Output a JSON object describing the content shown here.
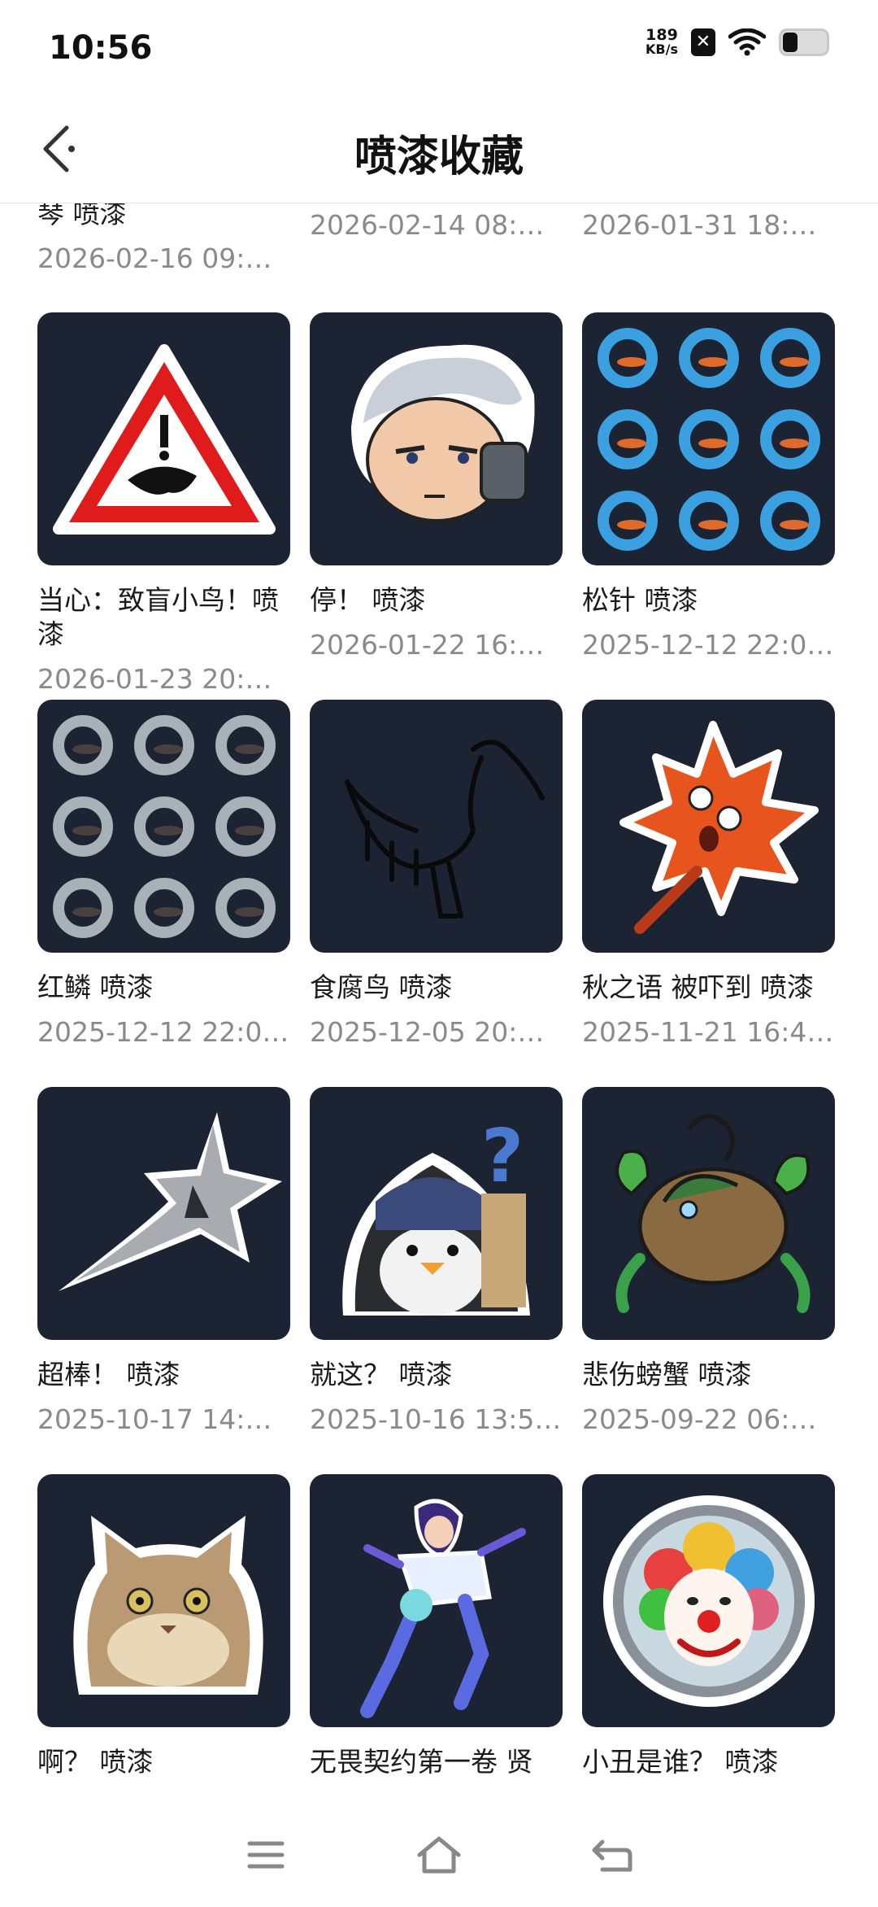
{
  "status_bar": {
    "time": "10:56",
    "net_speed_value": "189",
    "net_speed_unit": "KB/s",
    "icons": [
      "x-notification-icon",
      "wifi-icon",
      "battery-icon"
    ]
  },
  "header": {
    "title": "喷漆收藏",
    "back_icon": "back-arrow-icon"
  },
  "top_row": [
    {
      "name": "琴 喷漆",
      "date": "2026-02-16 09:…"
    },
    {
      "name": "",
      "date": "2026-02-14 08:…"
    },
    {
      "name": "",
      "date": "2026-01-31 18:…"
    }
  ],
  "sprays": [
    {
      "name": "当心：致盲小鸟！喷漆",
      "date": "2026-01-23 20:…",
      "icon": "warning-sign-bird-icon"
    },
    {
      "name": "停！ 喷漆",
      "date": "2026-01-22 16:…",
      "icon": "gray-hair-character-icon"
    },
    {
      "name": "松针 喷漆",
      "date": "2025-12-12 22:0…",
      "icon": "blue-koi-pattern-icon"
    },
    {
      "name": "红鳞 喷漆",
      "date": "2025-12-12 22:0…",
      "icon": "silver-koi-pattern-icon"
    },
    {
      "name": "食腐鸟 喷漆",
      "date": "2025-12-05 20:…",
      "icon": "scavenger-bird-sketch-icon"
    },
    {
      "name": "秋之语 被吓到 喷漆",
      "date": "2025-11-21 16:4…",
      "icon": "scared-maple-leaf-icon"
    },
    {
      "name": "超棒！ 喷漆",
      "date": "2025-10-17 14:…",
      "icon": "shooting-star-icon"
    },
    {
      "name": "就这？ 喷漆",
      "date": "2025-10-16 13:5…",
      "icon": "penguin-question-icon"
    },
    {
      "name": "悲伤螃蟹 喷漆",
      "date": "2025-09-22 06:…",
      "icon": "sad-crab-icon"
    },
    {
      "name": "啊？ 喷漆",
      "date": "",
      "icon": "grumpy-cat-icon"
    },
    {
      "name": "无畏契约第一卷 贤",
      "date": "",
      "icon": "flying-heroine-icon"
    },
    {
      "name": "小丑是谁？ 喷漆",
      "date": "",
      "icon": "clown-mirror-icon"
    }
  ],
  "nav_bar": {
    "items": [
      "menu-icon",
      "home-icon",
      "back-icon"
    ]
  }
}
